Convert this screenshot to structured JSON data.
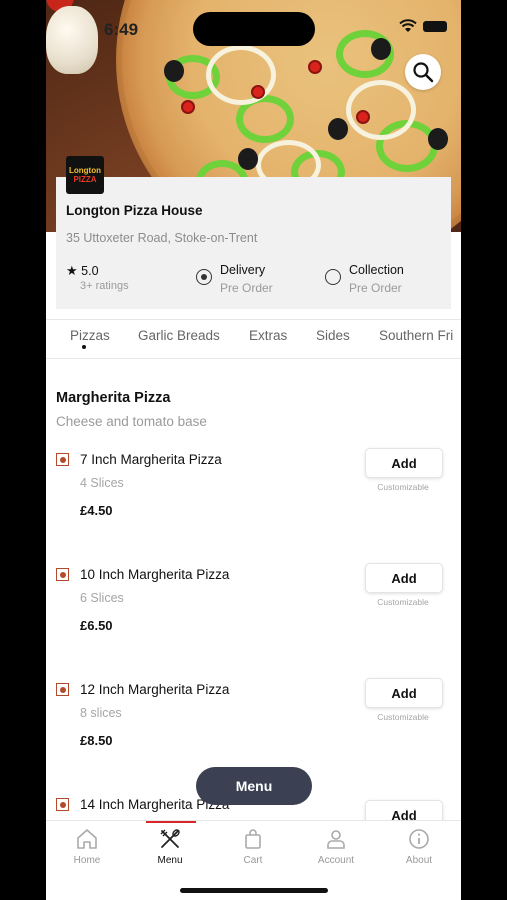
{
  "status": {
    "time": "6:49"
  },
  "restaurant": {
    "logo_text": [
      "Longton",
      "PIZZA"
    ],
    "name": "Longton Pizza House",
    "address": "35 Uttoxeter Road, Stoke-on-Trent",
    "rating": "5.0",
    "rating_count": "3+ ratings",
    "delivery": {
      "label": "Delivery",
      "sub": "Pre Order",
      "selected": true
    },
    "collection": {
      "label": "Collection",
      "sub": "Pre Order",
      "selected": false
    }
  },
  "tabs": [
    "Pizzas",
    "Garlic Breads",
    "Extras",
    "Sides",
    "Southern Fri"
  ],
  "section": {
    "title": "Margherita Pizza",
    "subtitle": "Cheese and tomato base"
  },
  "items": [
    {
      "name": "7 Inch Margherita Pizza",
      "desc": "4 Slices",
      "price": "£4.50",
      "add": "Add",
      "note": "Customizable"
    },
    {
      "name": "10 Inch Margherita Pizza",
      "desc": "6 Slices",
      "price": "£6.50",
      "add": "Add",
      "note": "Customizable"
    },
    {
      "name": "12 Inch Margherita Pizza",
      "desc": "8 slices",
      "price": "£8.50",
      "add": "Add",
      "note": "Customizable"
    },
    {
      "name": "14 Inch Margherita Pizza",
      "desc": "",
      "price": "",
      "add": "Add",
      "note": ""
    }
  ],
  "menu_button": "Menu",
  "bottom_nav": [
    {
      "label": "Home",
      "icon": "home-icon"
    },
    {
      "label": "Menu",
      "icon": "cutlery-icon"
    },
    {
      "label": "Cart",
      "icon": "bag-icon"
    },
    {
      "label": "Account",
      "icon": "user-icon"
    },
    {
      "label": "About",
      "icon": "info-icon"
    }
  ],
  "colors": {
    "accent": "#d9262a",
    "fab": "#3b4152",
    "veg_mark": "#b24a2c"
  }
}
